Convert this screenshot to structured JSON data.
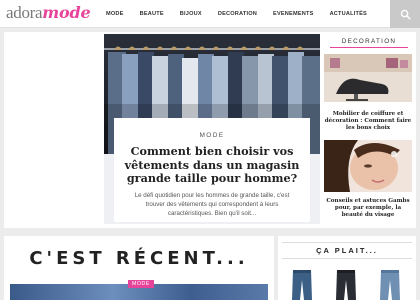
{
  "header": {
    "logo_main": "adora",
    "logo_accent": "mode",
    "nav": [
      "MODE",
      "BEAUTE",
      "BIJOUX",
      "DECORATION",
      "EVENEMENTS",
      "ACTUALITÉS"
    ],
    "search_icon": "search-icon"
  },
  "hero": {
    "tag": "MODE",
    "title": "Comment bien choisir vos vêtements dans un magasin grande taille pour homme?",
    "excerpt": "Le défi quotidien pour les hommes de grande taille, c'est trouver des vêtements qui correspondent à leurs caractéristiques. Bien qu'il soit..."
  },
  "sidebar": {
    "tag": "DECORATION",
    "articles": [
      {
        "title": "Mobilier de coiffure et décoration : Comment faire les bons choix"
      },
      {
        "title": "Conseils et astuces Gambs pour, par exemple, la beauté du visage"
      }
    ]
  },
  "recent": {
    "title": "C'EST RÉCENT...",
    "tag": "MODE"
  },
  "plait": {
    "title": "ÇA PLAIT..."
  },
  "colors": {
    "brand_pink": "#e6449b",
    "text_dark": "#222222"
  }
}
